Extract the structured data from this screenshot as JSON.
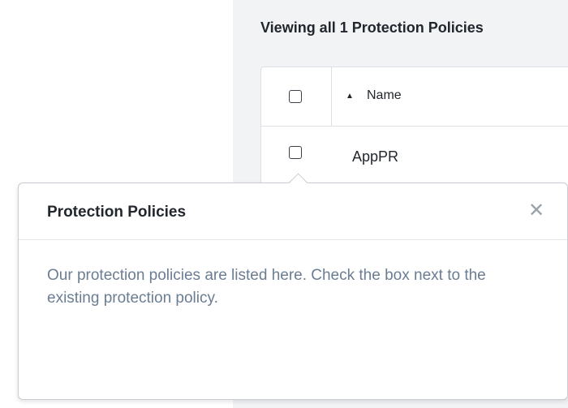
{
  "header": {
    "viewing_label": "Viewing all 1 Protection Policies"
  },
  "table": {
    "columns": [
      {
        "label": "Name",
        "sort_indicator": "▲"
      }
    ],
    "rows": [
      {
        "name": "AppPR"
      }
    ]
  },
  "popover": {
    "title": "Protection Policies",
    "close_glyph": "✕",
    "body": "Our protection policies are listed here. Check the box next to the existing protection policy."
  }
}
